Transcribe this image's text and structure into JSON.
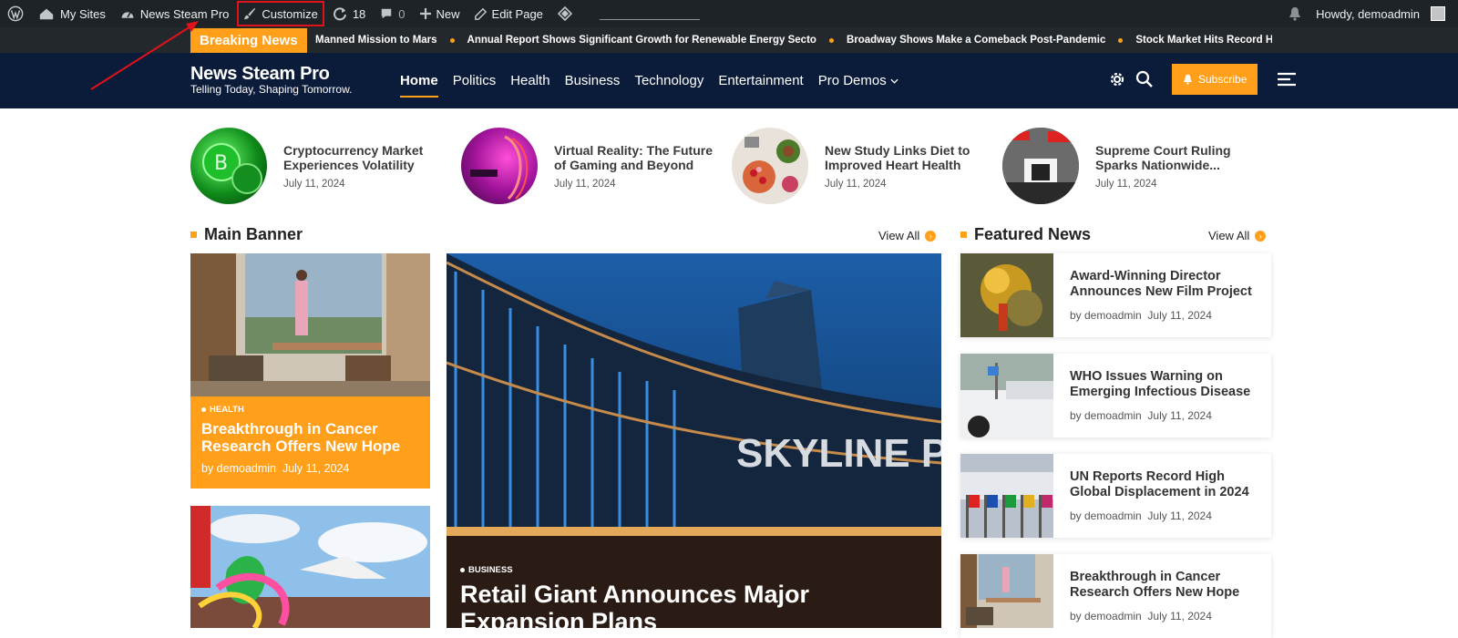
{
  "adminbar": {
    "my_sites": "My Sites",
    "site_name": "News Steam Pro",
    "customize": "Customize",
    "updates_count": "18",
    "comments_count": "0",
    "new": "New",
    "edit_page": "Edit Page",
    "howdy": "Howdy, demoadmin"
  },
  "ticker": {
    "label": "Breaking News",
    "items": [
      "Manned Mission to Mars",
      "Annual Report Shows Significant Growth for Renewable Energy Secto",
      "Broadway Shows Make a Comeback Post-Pandemic",
      "Stock Market Hits Record High Amid"
    ]
  },
  "header": {
    "brand_name": "News Steam Pro",
    "tagline": "Telling Today, Shaping Tomorrow.",
    "nav": [
      "Home",
      "Politics",
      "Health",
      "Business",
      "Technology",
      "Entertainment",
      "Pro Demos"
    ],
    "subscribe": "Subscribe"
  },
  "strip": [
    {
      "title": "Cryptocurrency Market Experiences Volatility",
      "date": "July 11, 2024"
    },
    {
      "title": "Virtual Reality: The Future of Gaming and Beyond",
      "date": "July 11, 2024"
    },
    {
      "title": "New Study Links Diet to Improved Heart Health",
      "date": "July 11, 2024"
    },
    {
      "title": "Supreme Court Ruling Sparks Nationwide...",
      "date": "July 11, 2024"
    }
  ],
  "main_banner": {
    "heading": "Main Banner",
    "view_all": "View All",
    "card1": {
      "category": "HEALTH",
      "title": "Breakthrough in Cancer Research Offers New Hope",
      "author": "by demoadmin",
      "date": "July 11, 2024"
    },
    "hero": {
      "category": "BUSINESS",
      "title": "Retail Giant Announces Major Expansion Plans",
      "sign": "SKYLINE PL"
    }
  },
  "featured": {
    "heading": "Featured News",
    "view_all": "View All",
    "items": [
      {
        "title": "Award-Winning Director Announces New Film Project",
        "author": "by demoadmin",
        "date": "July 11, 2024"
      },
      {
        "title": "WHO Issues Warning on Emerging Infectious Disease",
        "author": "by demoadmin",
        "date": "July 11, 2024"
      },
      {
        "title": "UN Reports Record High Global Displacement in 2024",
        "author": "by demoadmin",
        "date": "July 11, 2024"
      },
      {
        "title": "Breakthrough in Cancer Research Offers New Hope",
        "author": "by demoadmin",
        "date": "July 11, 2024"
      }
    ]
  }
}
